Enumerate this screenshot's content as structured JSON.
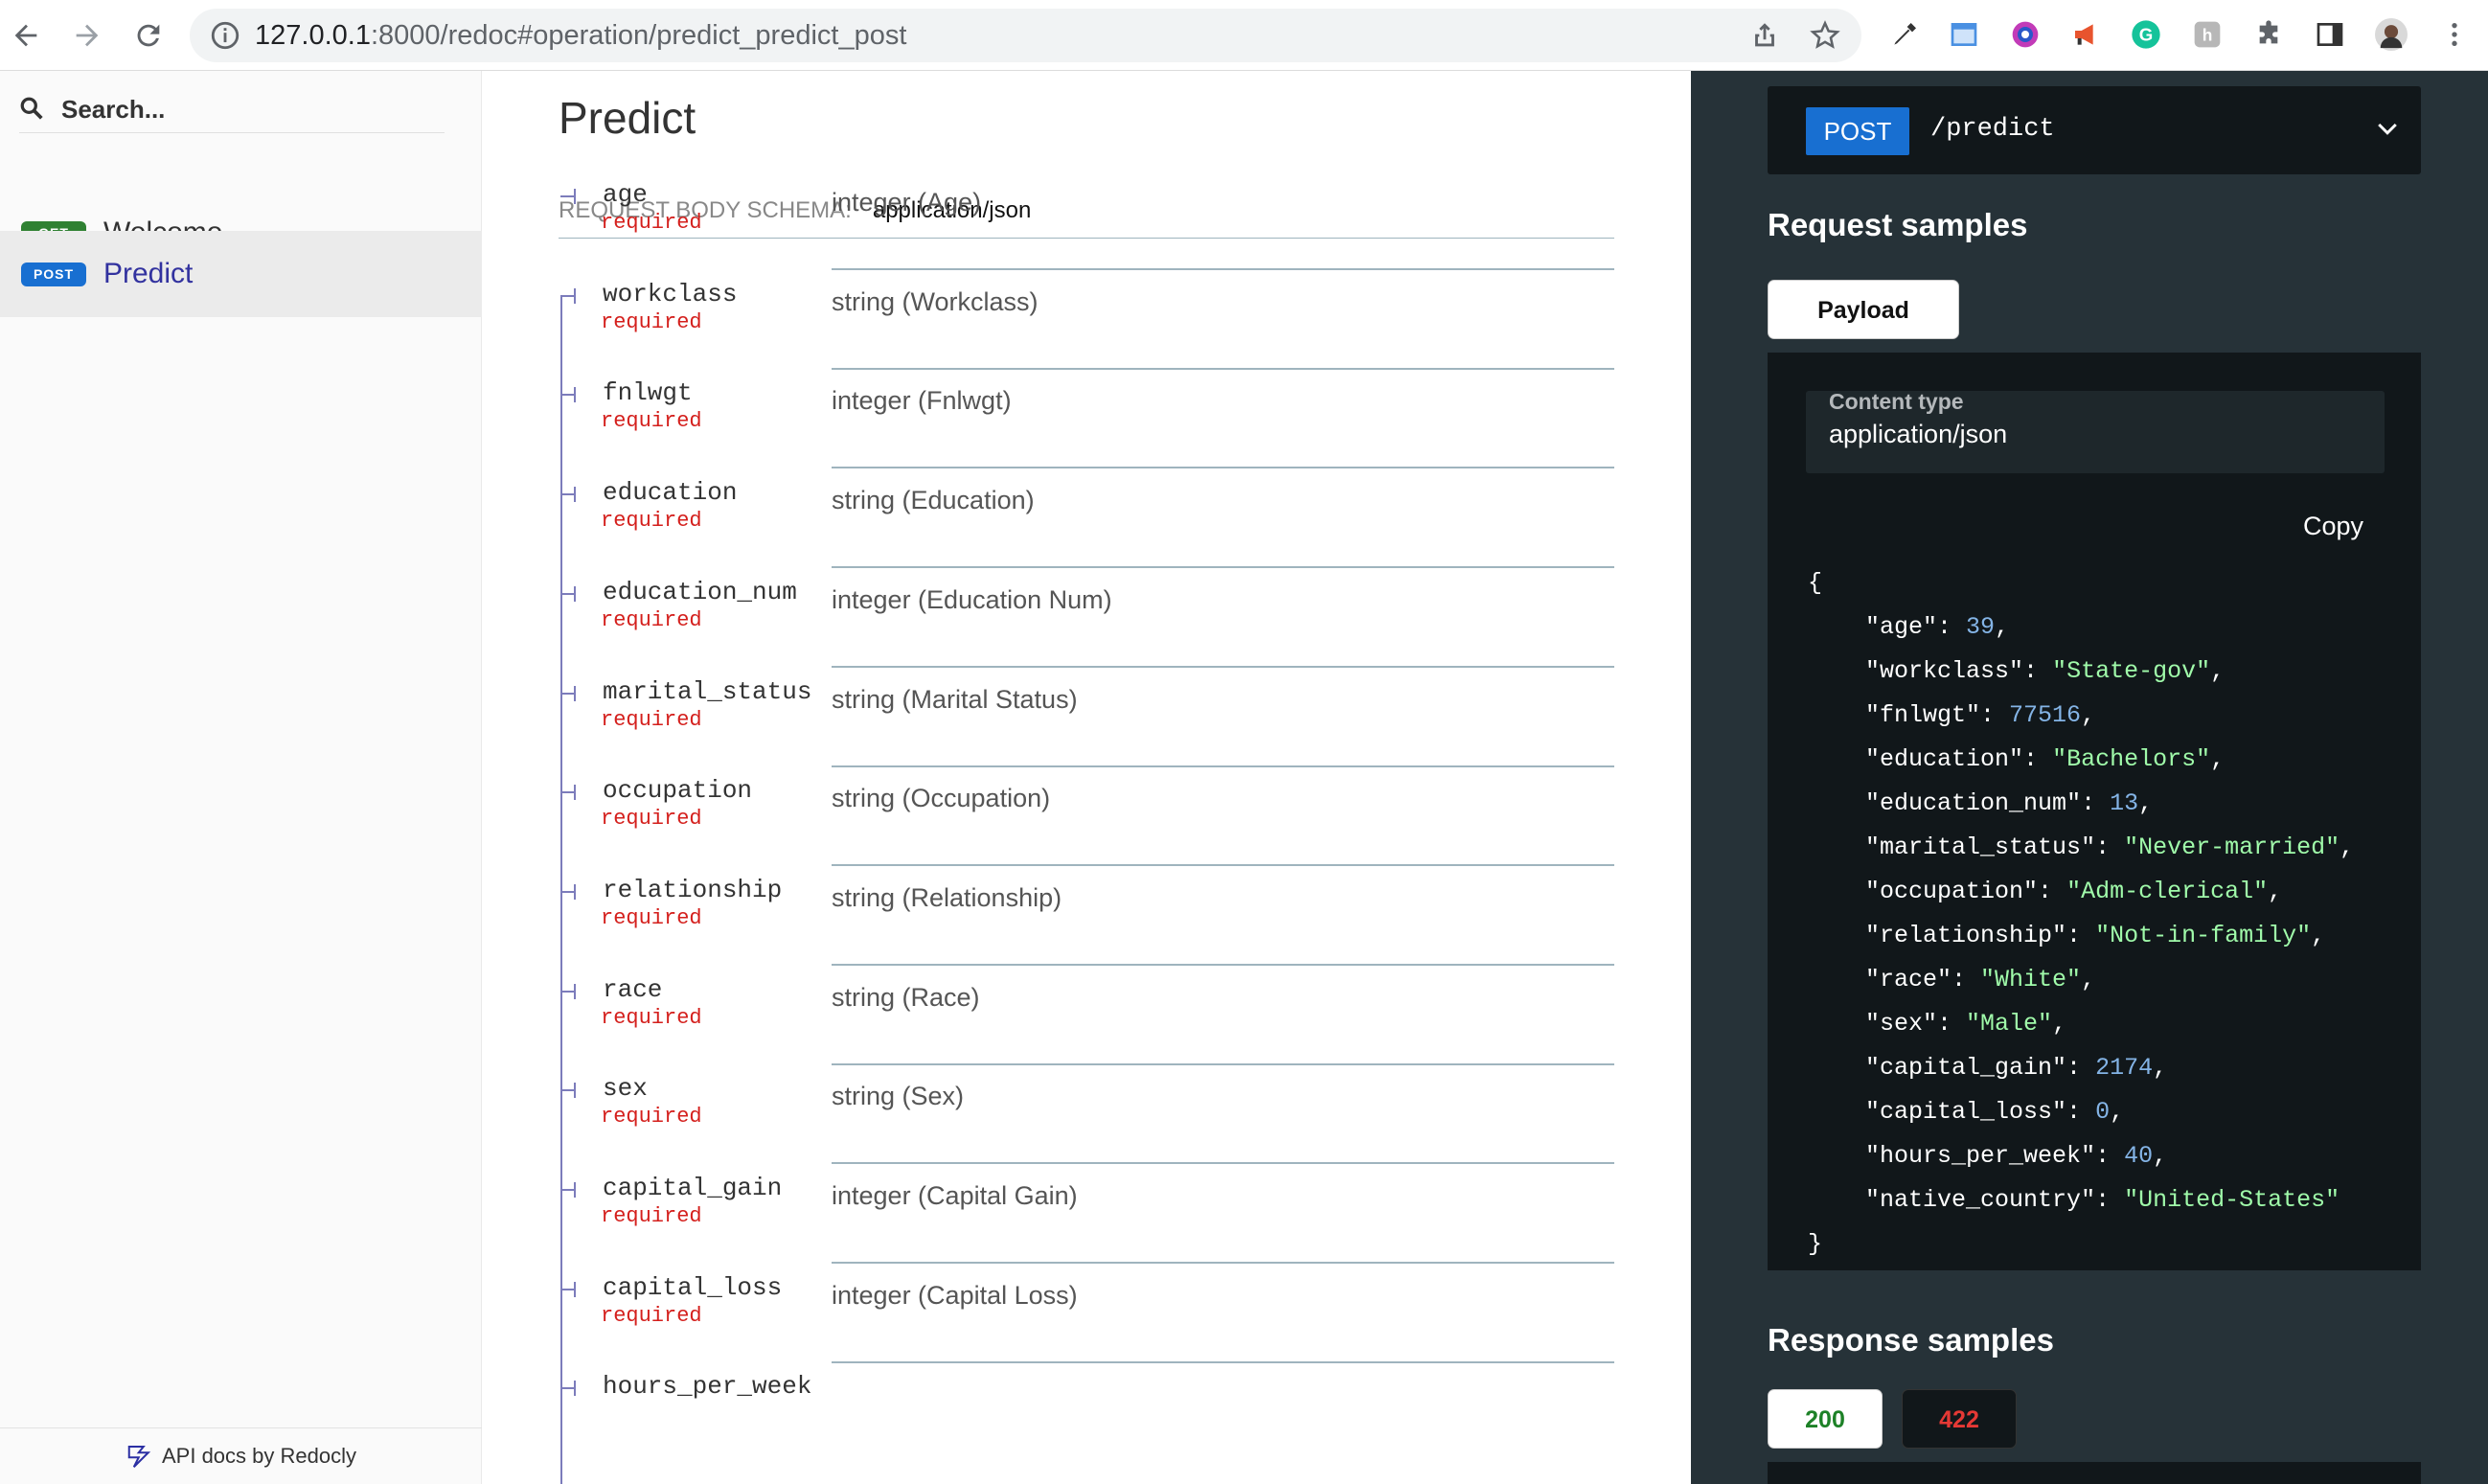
{
  "browser": {
    "url_host": "127.0.0.1",
    "url_rest": ":8000/redoc#operation/predict_predict_post"
  },
  "sidebar": {
    "search_placeholder": "Search...",
    "items": [
      {
        "method": "GET",
        "label": "Welcome"
      },
      {
        "method": "POST",
        "label": "Predict"
      }
    ],
    "footer": "API docs by Redocly"
  },
  "operation": {
    "title": "Predict",
    "schema_label": "REQUEST BODY SCHEMA:",
    "schema_type": "application/json",
    "required_label": "required",
    "properties": [
      {
        "name": "age",
        "type": "integer (Age)"
      },
      {
        "name": "workclass",
        "type": "string (Workclass)"
      },
      {
        "name": "fnlwgt",
        "type": "integer (Fnlwgt)"
      },
      {
        "name": "education",
        "type": "string (Education)"
      },
      {
        "name": "education_num",
        "type": "integer (Education Num)"
      },
      {
        "name": "marital_status",
        "type": "string (Marital Status)"
      },
      {
        "name": "occupation",
        "type": "string (Occupation)"
      },
      {
        "name": "relationship",
        "type": "string (Relationship)"
      },
      {
        "name": "race",
        "type": "string (Race)"
      },
      {
        "name": "sex",
        "type": "string (Sex)"
      },
      {
        "name": "capital_gain",
        "type": "integer (Capital Gain)"
      },
      {
        "name": "capital_loss",
        "type": "integer (Capital Loss)"
      },
      {
        "name": "hours_per_week",
        "type": ""
      }
    ]
  },
  "right_panel": {
    "method": "POST",
    "path": "/predict",
    "request_samples_title": "Request samples",
    "payload_tab": "Payload",
    "content_type_label": "Content type",
    "content_type_value": "application/json",
    "copy_label": "Copy",
    "sample_json": [
      {
        "key": "age",
        "value": "39",
        "kind": "num"
      },
      {
        "key": "workclass",
        "value": "\"State-gov\"",
        "kind": "str"
      },
      {
        "key": "fnlwgt",
        "value": "77516",
        "kind": "num"
      },
      {
        "key": "education",
        "value": "\"Bachelors\"",
        "kind": "str"
      },
      {
        "key": "education_num",
        "value": "13",
        "kind": "num"
      },
      {
        "key": "marital_status",
        "value": "\"Never-married\"",
        "kind": "str"
      },
      {
        "key": "occupation",
        "value": "\"Adm-clerical\"",
        "kind": "str"
      },
      {
        "key": "relationship",
        "value": "\"Not-in-family\"",
        "kind": "str"
      },
      {
        "key": "race",
        "value": "\"White\"",
        "kind": "str"
      },
      {
        "key": "sex",
        "value": "\"Male\"",
        "kind": "str"
      },
      {
        "key": "capital_gain",
        "value": "2174",
        "kind": "num"
      },
      {
        "key": "capital_loss",
        "value": "0",
        "kind": "num"
      },
      {
        "key": "hours_per_week",
        "value": "40",
        "kind": "num"
      },
      {
        "key": "native_country",
        "value": "\"United-States\"",
        "kind": "str"
      }
    ],
    "response_samples_title": "Response samples",
    "response_tabs": [
      "200",
      "422"
    ]
  },
  "colors": {
    "get": "#2f8132",
    "post": "#186fd1",
    "required": "#d41f1c",
    "panel_bg": "#263238",
    "code_bg": "#11171a"
  }
}
